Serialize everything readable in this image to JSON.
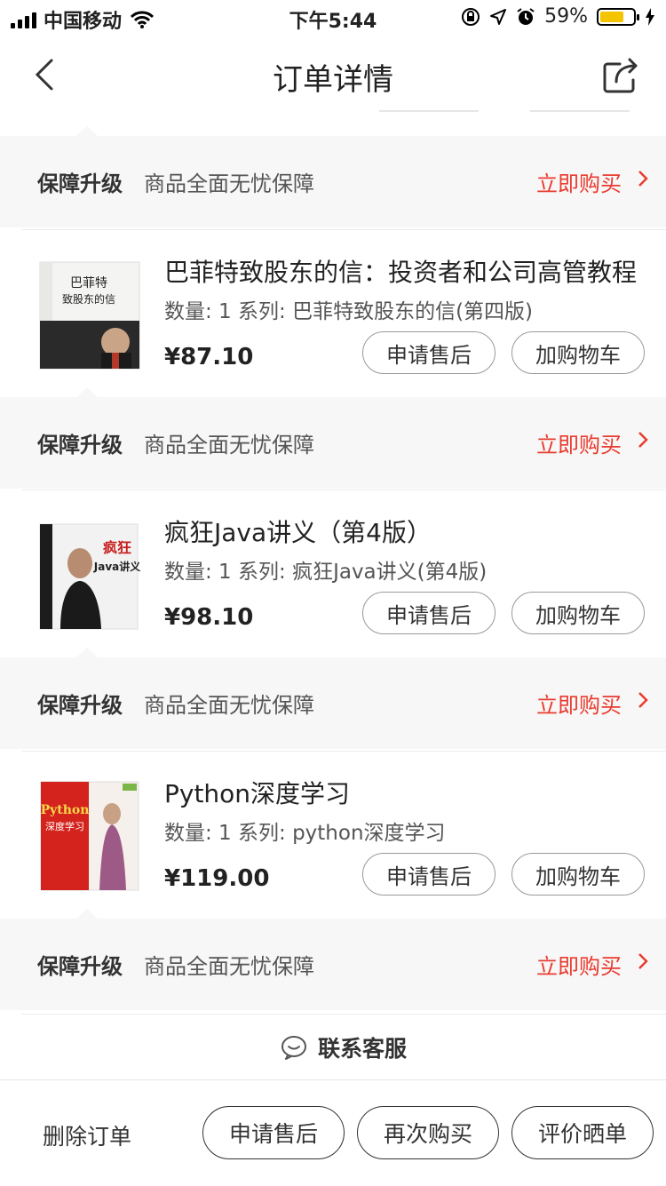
{
  "status_bar": {
    "carrier": "中国移动",
    "time": "下午5:44",
    "battery": "59%"
  },
  "nav": {
    "title": "订单详情"
  },
  "guarantee": {
    "title": "保障升级",
    "desc": "商品全面无忧保障",
    "buy": "立即购买"
  },
  "products": [
    {
      "title": "巴菲特致股东的信：投资者和公司高管教程",
      "meta": "数量: 1 系列: 巴菲特致股东的信(第四版)",
      "price": "¥87.10",
      "cover_title": "巴菲特致股东的信",
      "after_sale": "申请售后",
      "add_cart": "加购物车"
    },
    {
      "title": "疯狂Java讲义（第4版）",
      "meta": "数量: 1 系列: 疯狂Java讲义(第4版)",
      "price": "¥98.10",
      "cover_title": "疯狂 Java讲义",
      "after_sale": "申请售后",
      "add_cart": "加购物车"
    },
    {
      "title": "Python深度学习",
      "meta": "数量: 1 系列: python深度学习",
      "price": "¥119.00",
      "cover_title": "Python 深度学习",
      "after_sale": "申请售后",
      "add_cart": "加购物车"
    }
  ],
  "service": {
    "label": "联系客服"
  },
  "bottom_bar": {
    "delete_order": "删除订单",
    "after_sale": "申请售后",
    "buy_again": "再次购买",
    "review": "评价晒单"
  }
}
